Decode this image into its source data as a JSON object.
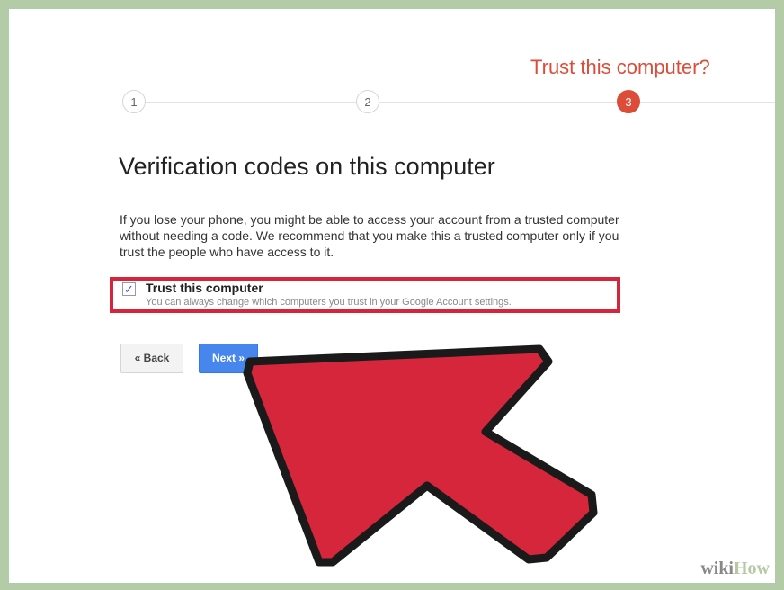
{
  "wizard": {
    "step_title": "Trust this computer?",
    "steps": [
      {
        "label": "1",
        "active": false
      },
      {
        "label": "2",
        "active": false
      },
      {
        "label": "3",
        "active": true
      }
    ]
  },
  "content": {
    "heading": "Verification codes on this computer",
    "body": "If you lose your phone, you might be able to access your account from a trusted computer without needing a code. We recommend that you make this a trusted computer only if you trust the people who have access to it.",
    "checkbox": {
      "checked": true,
      "label": "Trust this computer",
      "sublabel": "You can always change which computers you trust in your Google Account settings."
    }
  },
  "buttons": {
    "back_label": "« Back",
    "next_label": "Next »"
  },
  "annotation": {
    "highlight_color": "#d6243a",
    "arrow_color": "#d5263b"
  },
  "watermark": {
    "wiki": "wiki",
    "how": "How"
  },
  "colors": {
    "accent_red": "#dd4b39",
    "primary_blue": "#4787ed",
    "frame_green": "#b3cba6"
  }
}
